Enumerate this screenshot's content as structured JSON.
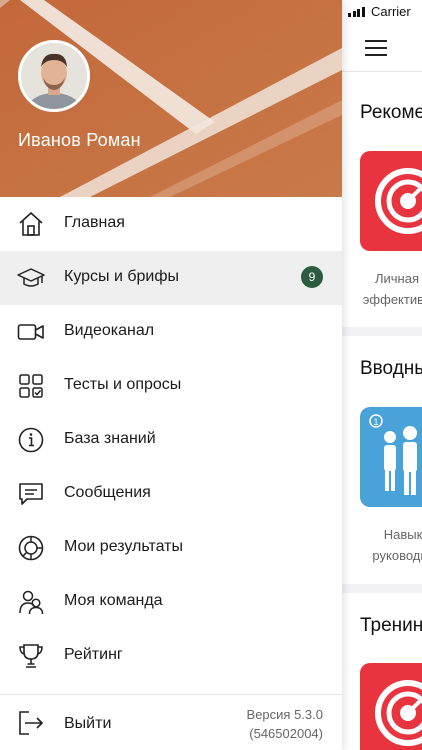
{
  "status_bar": {
    "carrier": "Carrier"
  },
  "user": {
    "name": "Иванов Роман"
  },
  "menu": {
    "items": [
      {
        "label": "Главная"
      },
      {
        "label": "Курсы и брифы",
        "badge": "9"
      },
      {
        "label": "Видеоканал"
      },
      {
        "label": "Тесты и опросы"
      },
      {
        "label": "База знаний"
      },
      {
        "label": "Сообщения"
      },
      {
        "label": "Мои результаты"
      },
      {
        "label": "Моя команда"
      },
      {
        "label": "Рейтинг"
      }
    ]
  },
  "footer": {
    "logout_label": "Выйти",
    "version": "Версия 5.3.0",
    "build": "(546502004)"
  },
  "background": {
    "sections": [
      {
        "title": "Рекоме",
        "caption_1": "Личная",
        "caption_2": "эффективн"
      },
      {
        "title": "Вводны",
        "caption_1": "Навык",
        "caption_2": "руководит"
      },
      {
        "title": "Тренин"
      }
    ]
  },
  "colors": {
    "court": "#c7703f",
    "badge": "#2b5c3f",
    "active_row": "#efefef",
    "thumb_red": "#e8343f",
    "thumb_blue": "#4aa3d8"
  },
  "icons": [
    "home-icon",
    "graduation-cap-icon",
    "video-camera-icon",
    "tests-grid-icon",
    "info-icon",
    "message-icon",
    "results-chart-icon",
    "team-icon",
    "trophy-icon",
    "logout-icon",
    "menu-icon",
    "target-icon",
    "people-icon"
  ]
}
